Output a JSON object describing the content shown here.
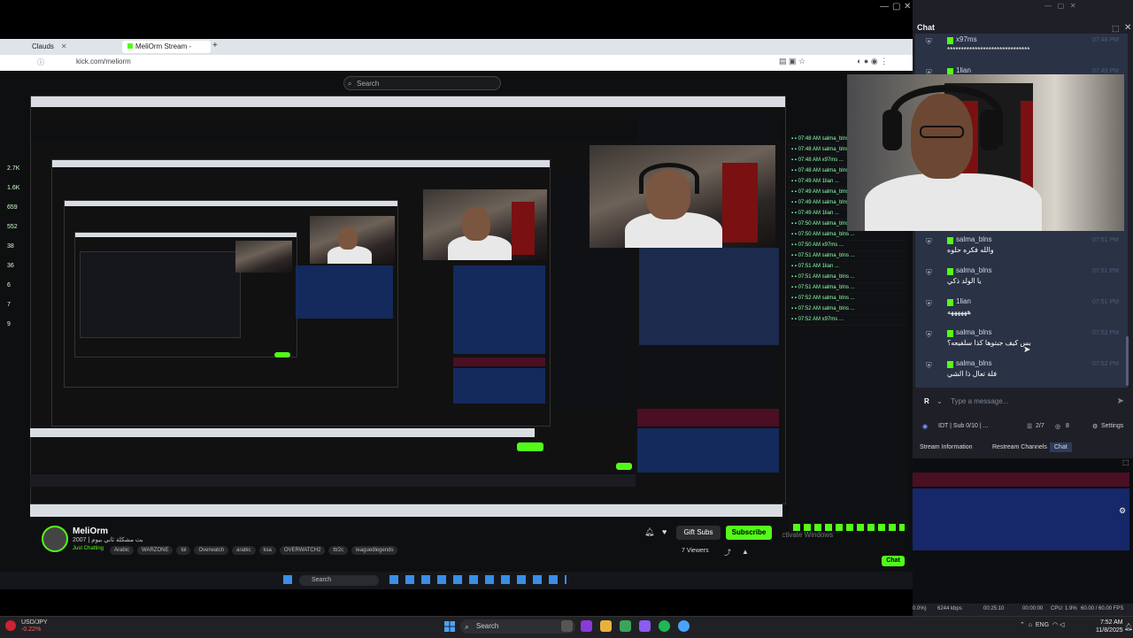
{
  "capture": {
    "browser_tabs": [
      {
        "label": "Clauds",
        "active": false
      },
      {
        "label": "MeliOrm Stream - Watch Live o",
        "active": true
      }
    ],
    "url": "kick.com/meliorm",
    "search_placeholder": "Search",
    "left_rail_counts": [
      "2.7K",
      "1.6K",
      "659",
      "552",
      "38",
      "36",
      "6",
      "7",
      "9"
    ],
    "streamer": {
      "name": "MeliOrm",
      "title": "2007 | بث مشكلة ثاني بيوم",
      "category": "Just Chatting",
      "tags": [
        "Arabic",
        "WARZONE",
        "lol",
        "Overwatch",
        "arabic",
        "ksa",
        "OVERWATCH2",
        "ttr2c",
        "leaguedlegends"
      ],
      "gift_label": "Gift Subs",
      "subscribe_label": "Subscribe",
      "viewers": "7 Viewers"
    },
    "inner_taskbar_search": "Search",
    "activate_windows": "Activate Windows"
  },
  "obs": {
    "chat_title": "Chat",
    "messages": [
      {
        "user": "x97ms",
        "text": "******************************",
        "time": "07:48 PM"
      },
      {
        "user": "1lian",
        "text": "",
        "time": "07:49 PM"
      },
      {
        "user": "salma_blns",
        "text": "والله فكره حلوه",
        "time": "07:51 PM"
      },
      {
        "user": "salma_blns",
        "text": "يا الولد ذكي",
        "time": "07:51 PM"
      },
      {
        "user": "1lian",
        "text": "ههههههه",
        "time": "07:51 PM"
      },
      {
        "user": "salma_blns",
        "text": "بس كيف جبتوها كذا سلفيعه؟",
        "time": "07:52 PM"
      },
      {
        "user": "salma_blns",
        "text": "فلة تعال ذا الشي",
        "time": "07:52 PM"
      }
    ],
    "input_placeholder": "Type a message...",
    "input_badge": "R",
    "footer": "IDT | Sub 0/10 | ...",
    "footer_count": "2/7",
    "footer_viewers": "8",
    "settings_label": "Settings",
    "tabs": [
      {
        "label": "Stream Information",
        "active": false
      },
      {
        "label": "Restream Channels",
        "active": false
      },
      {
        "label": "Chat",
        "active": true
      }
    ],
    "status": {
      "drop": "0.0%)",
      "bitrate": "6244 kbps",
      "live": "00:25:10",
      "rec": "00:00:00",
      "cpu": "CPU: 1.9%",
      "fps": "60.00 / 60.00 FPS"
    }
  },
  "taskbar": {
    "ticker_symbol": "USD/JPY",
    "ticker_value": "-0.22%",
    "search_placeholder": "Search",
    "lang": "ENG",
    "time": "7:52 AM",
    "date": "11/8/2025"
  },
  "colors": {
    "kick_green": "#53fc18",
    "chat_bg": "#2a3245",
    "obs_bg": "#1f2027"
  }
}
